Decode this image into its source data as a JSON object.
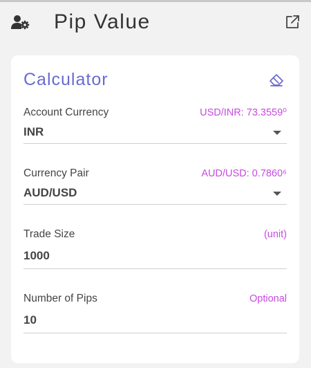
{
  "header": {
    "title": "Pip Value",
    "user_settings_icon": "user-gear-icon",
    "external_icon": "external-link-icon"
  },
  "card": {
    "title": "Calculator",
    "clear_icon": "eraser-icon"
  },
  "fields": {
    "account_currency": {
      "label": "Account Currency",
      "hint": "USD/INR: 73.3559⁰",
      "value": "INR"
    },
    "currency_pair": {
      "label": "Currency Pair",
      "hint": "AUD/USD: 0.7860⁶",
      "value": "AUD/USD"
    },
    "trade_size": {
      "label": "Trade Size",
      "hint": "(unit)",
      "value": "1000"
    },
    "number_of_pips": {
      "label": "Number of Pips",
      "hint": "Optional",
      "value": "10"
    }
  },
  "colors": {
    "accent": "#6a6ad0",
    "hint": "#c74ae0",
    "background": "#f2f2f2",
    "card": "#ffffff"
  }
}
